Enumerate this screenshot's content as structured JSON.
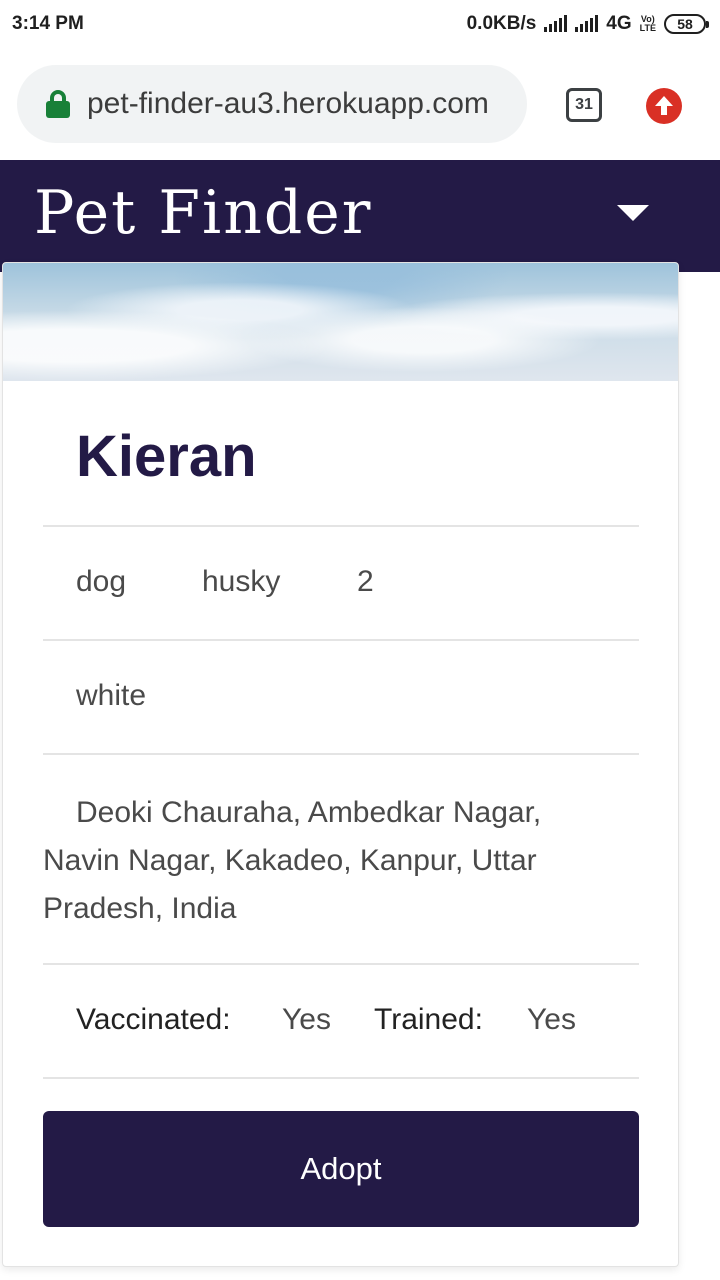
{
  "status_bar": {
    "time": "3:14 PM",
    "speed": "0.0KB/s",
    "network": "4G",
    "volte": [
      "Vo)",
      "LTE"
    ],
    "battery": "58"
  },
  "browser": {
    "url": "pet-finder-au3.herokuapp.com",
    "tab_count": "31",
    "lock_icon": "lock-icon",
    "update_icon": "arrow-up-circle-icon"
  },
  "navbar": {
    "brand": "Pet Finder",
    "menu_icon": "caret-down-icon",
    "background": "#231a46"
  },
  "pet": {
    "name": "Kieran",
    "type": "dog",
    "breed": "husky",
    "age": "2",
    "color": "white",
    "address": "Deoki Chauraha, Ambedkar Nagar, Navin Nagar, Kakadeo, Kanpur, Uttar Pradesh, India",
    "vaccinated_label": "Vaccinated:",
    "vaccinated_value": "Yes",
    "trained_label": "Trained:",
    "trained_value": "Yes"
  },
  "actions": {
    "adopt_label": "Adopt"
  },
  "colors": {
    "primary": "#231a46",
    "lock_green": "#188038",
    "update_red": "#d93025"
  }
}
